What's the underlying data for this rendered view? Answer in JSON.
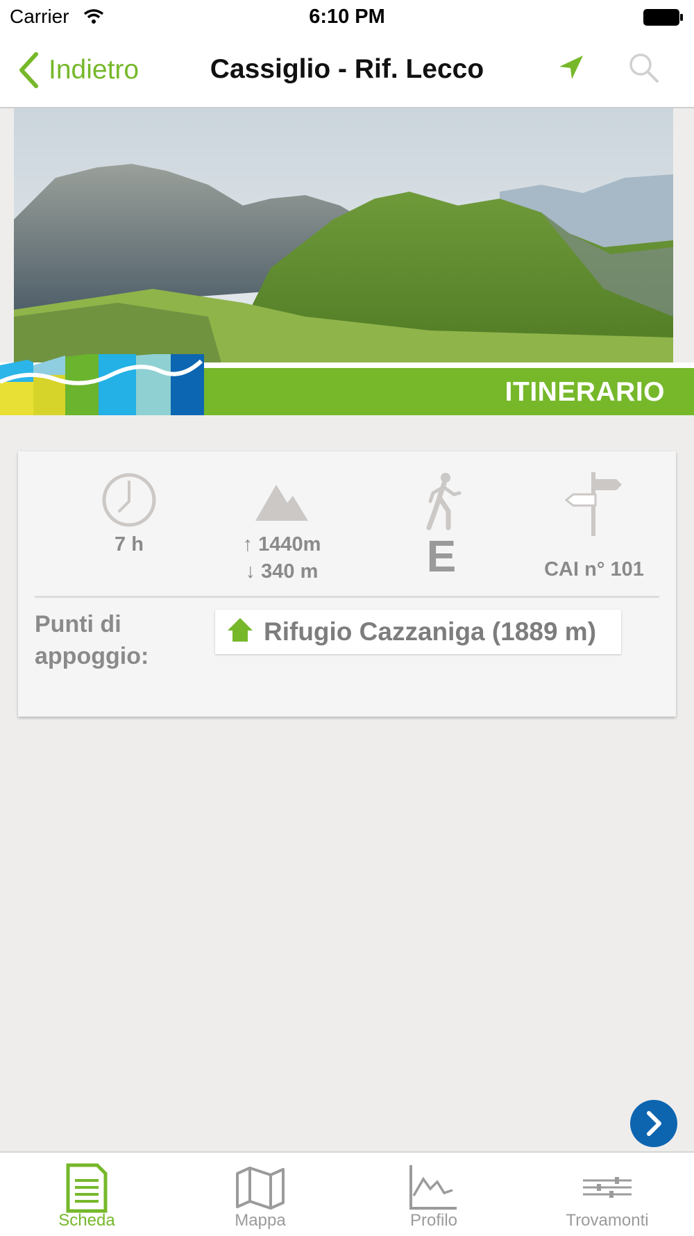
{
  "status_bar": {
    "carrier": "Carrier",
    "time": "6:10 PM"
  },
  "nav": {
    "back_label": "Indietro",
    "title": "Cassiglio - Rif. Lecco"
  },
  "banner": {
    "label": "ITINERARIO"
  },
  "stats": {
    "duration": "7 h",
    "ascent": "↑ 1440m",
    "descent": "↓ 340 m",
    "difficulty": "E",
    "trail": "CAI n° 101"
  },
  "support": {
    "label": "Punti di appoggio:",
    "items": [
      "Rifugio Cazzaniga (1889 m)"
    ]
  },
  "tabs": [
    {
      "label": "Scheda",
      "icon": "document-icon",
      "active": true
    },
    {
      "label": "Mappa",
      "icon": "map-icon",
      "active": false
    },
    {
      "label": "Profilo",
      "icon": "profile-chart-icon",
      "active": false
    },
    {
      "label": "Trovamonti",
      "icon": "sliders-icon",
      "active": false
    }
  ],
  "colors": {
    "accent": "#76b82a",
    "next_button": "#0d65b0",
    "muted_text": "#8a8a8a"
  }
}
